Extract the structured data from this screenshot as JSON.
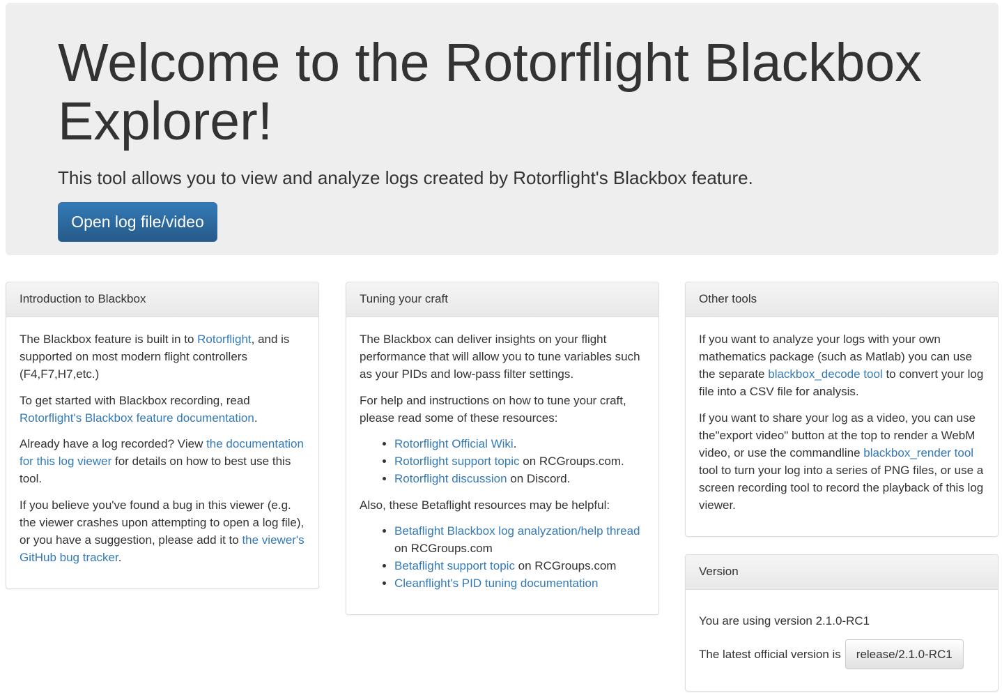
{
  "jumbotron": {
    "title": "Welcome to the Rotorflight Blackbox Explorer!",
    "lead": "This tool allows you to view and analyze logs created by Rotorflight's Blackbox feature.",
    "open_button": "Open log file/video"
  },
  "intro": {
    "heading": "Introduction to Blackbox",
    "p1_a": "The Blackbox feature is built in to ",
    "p1_link": "Rotorflight",
    "p1_b": ", and is supported on most modern flight controllers (F4,F7,H7,etc.)",
    "p2_a": "To get started with Blackbox recording, read ",
    "p2_link": "Rotorflight's Blackbox feature documentation",
    "p2_b": ".",
    "p3_a": "Already have a log recorded? View ",
    "p3_link": "the documentation for this log viewer",
    "p3_b": " for details on how to best use this tool.",
    "p4_a": "If you believe you've found a bug in this viewer (e.g. the viewer crashes upon attempting to open a log file), or you have a suggestion, please add it to ",
    "p4_link": "the viewer's GitHub bug tracker",
    "p4_b": "."
  },
  "tuning": {
    "heading": "Tuning your craft",
    "p1": "The Blackbox can deliver insights on your flight performance that will allow you to tune variables such as your PIDs and low-pass filter settings.",
    "p2": "For help and instructions on how to tune your craft, please read some of these resources:",
    "list1": [
      {
        "link": "Rotorflight Official Wiki",
        "suffix": "."
      },
      {
        "link": "Rotorflight support topic",
        "suffix": " on RCGroups.com."
      },
      {
        "link": "Rotorflight discussion",
        "suffix": " on Discord."
      }
    ],
    "p3": "Also, these Betaflight resources may be helpful:",
    "list2": [
      {
        "link": "Betaflight Blackbox log analyzation/help thread",
        "suffix": " on RCGroups.com"
      },
      {
        "link": "Betaflight support topic",
        "suffix": " on RCGroups.com"
      },
      {
        "link": "Cleanflight's PID tuning documentation",
        "suffix": ""
      }
    ]
  },
  "other": {
    "heading": "Other tools",
    "p1_a": "If you want to analyze your logs with your own mathematics package (such as Matlab) you can use the separate ",
    "p1_link": "blackbox_decode tool",
    "p1_b": " to convert your log file into a CSV file for analysis.",
    "p2_a": "If you want to share your log as a video, you can use the\"export video\" button at the top to render a WebM video, or use the commandline ",
    "p2_link": "blackbox_render tool",
    "p2_b": " tool to turn your log into a series of PNG files, or use a screen recording tool to record the playback of this log viewer."
  },
  "version": {
    "heading": "Version",
    "using_text": "You are using version 2.1.0-RC1",
    "latest_label": "The latest official version is",
    "latest_value": "release/2.1.0-RC1"
  }
}
